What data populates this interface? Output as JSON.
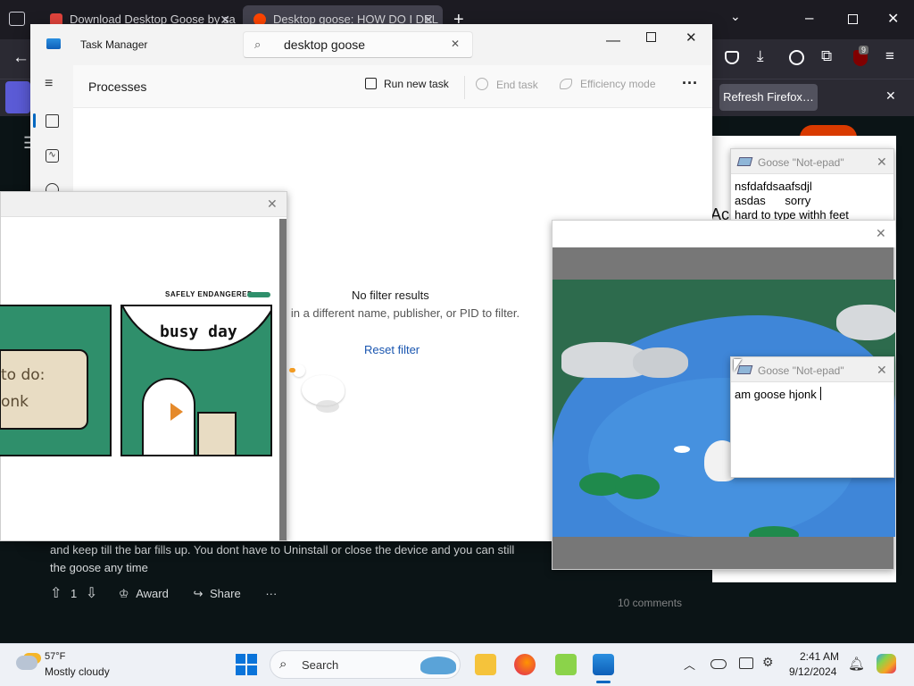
{
  "browser": {
    "tabs": [
      {
        "label": "Download Desktop Goose by sa"
      },
      {
        "label": "Desktop goose: HOW DO I DEL"
      }
    ],
    "new_tab_label": "+",
    "extension_badge": "9",
    "notice_button": "Refresh Firefox…"
  },
  "reddit": {
    "post_line1": "and keep till the bar fills up. You dont have to Uninstall or close the device and you can still",
    "post_line2": "the goose any time",
    "vote_count": "1",
    "award_label": "Award",
    "share_label": "Share",
    "more_label": "···",
    "comments_label": "10 comments",
    "partial_heading": "Acc"
  },
  "task_manager": {
    "title": "Task Manager",
    "search_value": "desktop goose",
    "page_title": "Processes",
    "run_new_task": "Run new task",
    "end_task": "End task",
    "efficiency_mode": "Efficiency mode",
    "more": "···",
    "empty_title": "No filter results",
    "empty_sub": "g in a different name, publisher, or PID to filter.",
    "reset_filter": "Reset filter"
  },
  "meme_popup": {
    "brand": "SAFELY ENDANGERED",
    "panel1_text": "to do:\nonk",
    "panel2_text": "busy day"
  },
  "notepad_1": {
    "title": "Goose \"Not-epad\"",
    "lines": [
      "nsfdafdsaafsdjl",
      "asdas      sorry",
      "hard to type withh feet"
    ]
  },
  "notepad_2": {
    "title": "Goose \"Not-epad\"",
    "text": "am goose hjonk"
  },
  "taskbar": {
    "weather_temp": "57°F",
    "weather_desc": "Mostly cloudy",
    "search_label": "Search",
    "time": "2:41 AM",
    "date": "9/12/2024"
  },
  "colors": {
    "meme_green": "#2f8f6b",
    "pond_blue": "#3f86d8",
    "link_blue": "#1a56b0"
  }
}
